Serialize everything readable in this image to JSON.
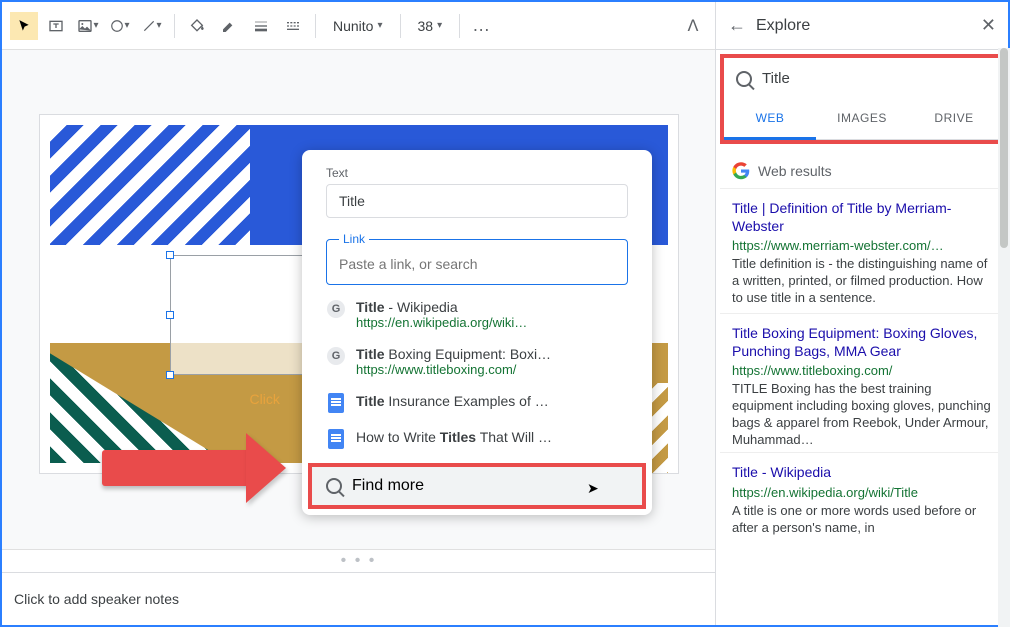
{
  "toolbar": {
    "font_name": "Nunito",
    "font_size": "38"
  },
  "slide": {
    "placeholder_visible": "Click"
  },
  "link_popup": {
    "text_label": "Text",
    "text_value": "Title",
    "link_label": "Link",
    "link_placeholder": "Paste a link, or search",
    "results": [
      {
        "title_prefix": "Title",
        "title_rest": " - Wikipedia",
        "url": "https://en.wikipedia.org/wiki…",
        "type": "web"
      },
      {
        "title_prefix": "Title",
        "title_rest": " Boxing Equipment: Boxi…",
        "url": "https://www.titleboxing.com/",
        "type": "web"
      },
      {
        "title_prefix": "Title",
        "title_rest": " Insurance Examples of …",
        "url": "",
        "type": "doc"
      },
      {
        "title_prefix": "",
        "title_rest_pre": "How to Write ",
        "title_bold": "Titles",
        "title_rest": " That Will …",
        "url": "",
        "type": "doc"
      }
    ],
    "find_more": "Find more"
  },
  "speaker_notes_placeholder": "Click to add speaker notes",
  "explore": {
    "title": "Explore",
    "search_value": "Title",
    "tabs": {
      "web": "WEB",
      "images": "IMAGES",
      "drive": "DRIVE"
    },
    "section": "Web results",
    "results": [
      {
        "title": "Title | Definition of Title by Merriam-Webster",
        "url": "https://www.merriam-webster.com/…",
        "snippet": "Title definition is - the distinguishing name of a written, printed, or filmed production. How to use title in a sentence."
      },
      {
        "title": "Title Boxing Equipment: Boxing Gloves, Punching Bags, MMA Gear",
        "url": "https://www.titleboxing.com/",
        "snippet": "TITLE Boxing has the best training equipment including boxing gloves, punching bags & apparel from Reebok, Under Armour, Muhammad…"
      },
      {
        "title": "Title - Wikipedia",
        "url": "https://en.wikipedia.org/wiki/Title",
        "snippet": "A title is one or more words used before or after a person's name, in"
      }
    ]
  }
}
